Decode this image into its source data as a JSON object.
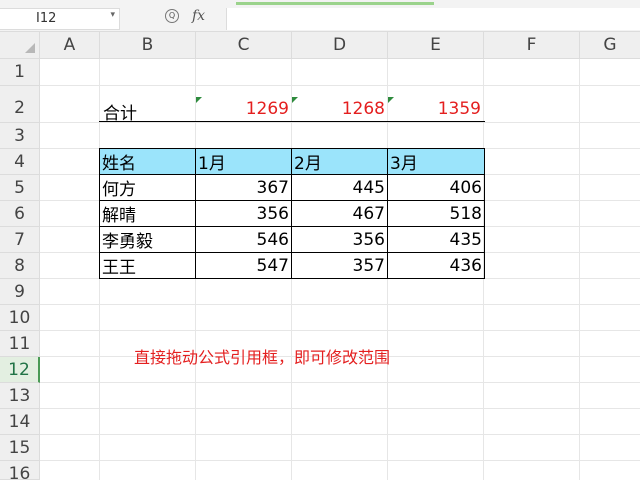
{
  "formula_bar": {
    "cell_ref": "I12",
    "fx_label": "fx"
  },
  "columns": [
    "A",
    "B",
    "C",
    "D",
    "E",
    "F",
    "G"
  ],
  "rows": [
    "1",
    "2",
    "3",
    "4",
    "5",
    "6",
    "7",
    "8",
    "9",
    "10",
    "11",
    "12",
    "13",
    "14",
    "15",
    "16"
  ],
  "selected_row": "12",
  "sum_row": {
    "label": "合计",
    "values": [
      "1269",
      "1268",
      "1359"
    ]
  },
  "table": {
    "headers": [
      "姓名",
      "1月",
      "2月",
      "3月"
    ],
    "rows": [
      [
        "何方",
        "367",
        "445",
        "406"
      ],
      [
        "解晴",
        "356",
        "467",
        "518"
      ],
      [
        "李勇毅",
        "546",
        "356",
        "435"
      ],
      [
        "王王",
        "547",
        "357",
        "436"
      ]
    ]
  },
  "note": "直接拖动公式引用框，即可修改范围",
  "colors": {
    "accent_red": "#e41f1f",
    "header_fill": "#9be4fb",
    "selection_green": "#217346"
  }
}
